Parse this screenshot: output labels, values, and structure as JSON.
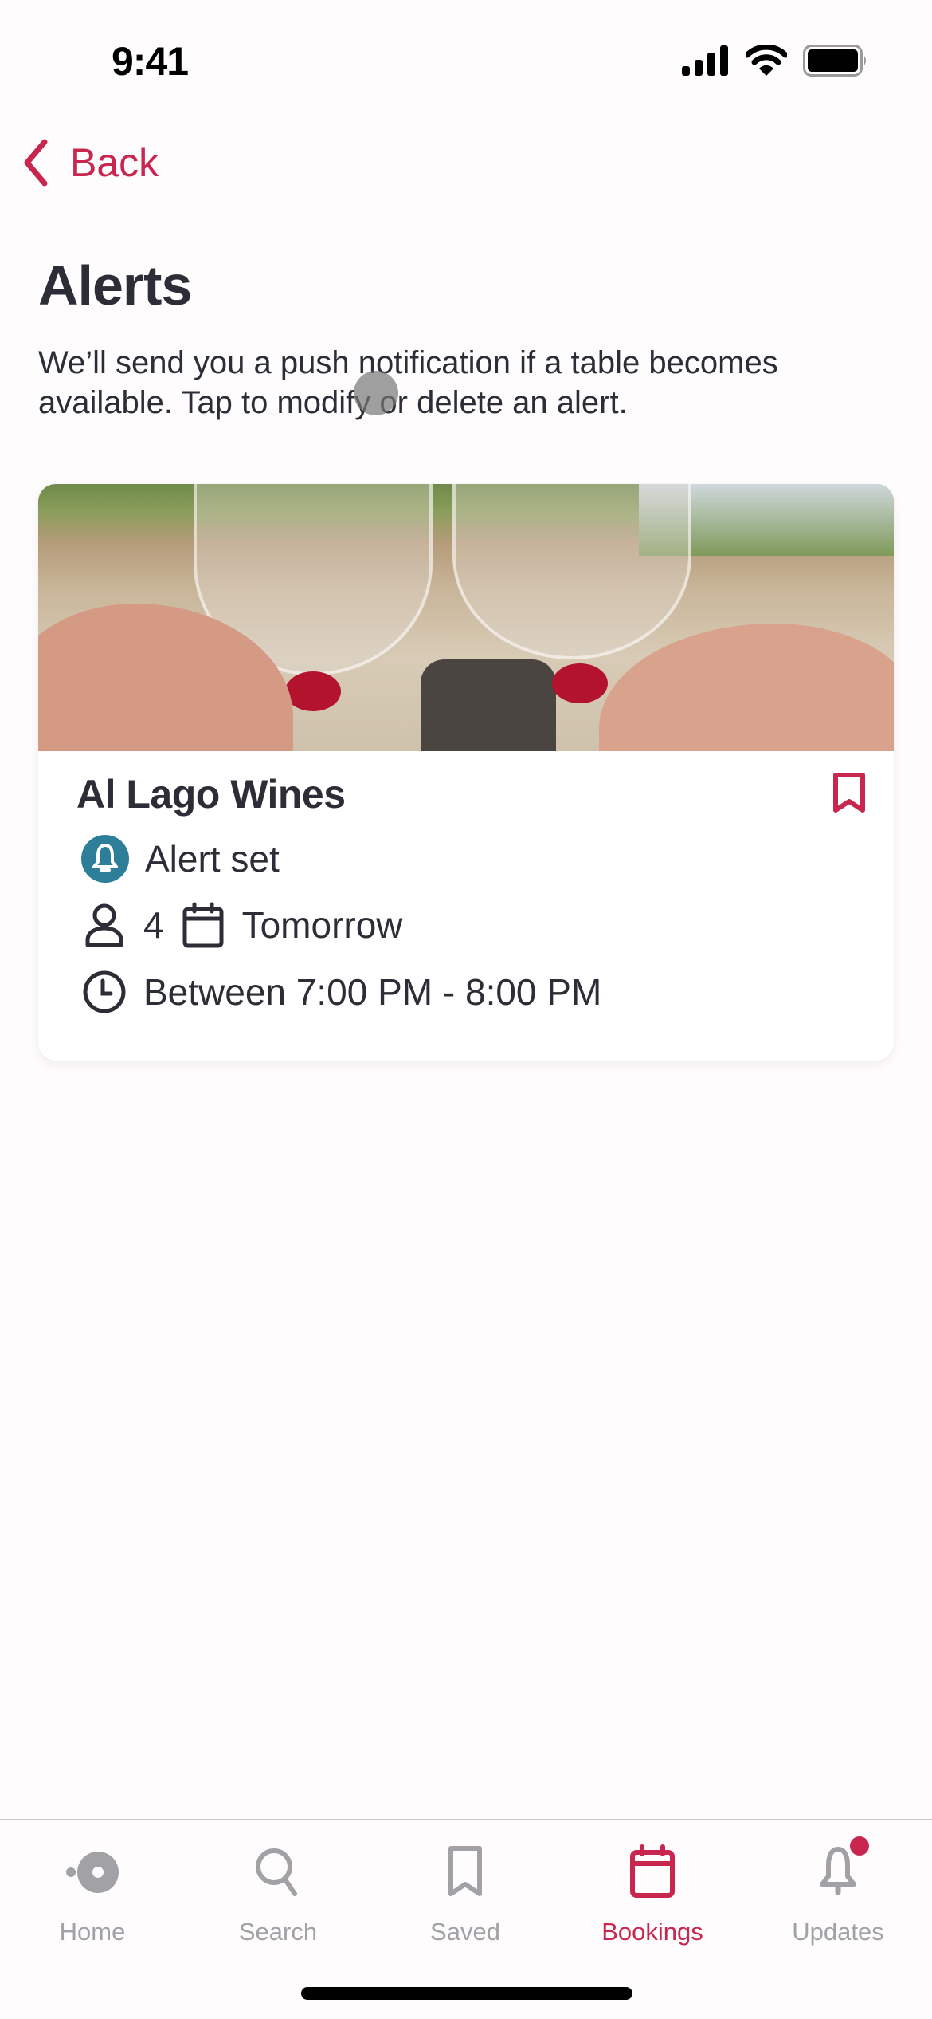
{
  "status_bar": {
    "time": "9:41",
    "icons": [
      "cellular-signal-icon",
      "wifi-icon",
      "battery-icon"
    ]
  },
  "nav": {
    "back_label": "Back",
    "back_icon": "chevron-left-icon"
  },
  "page": {
    "title": "Alerts",
    "description": "We’ll send you a push notification if a table becomes available. Tap to modify or delete an alert."
  },
  "alerts": [
    {
      "restaurant_name": "Al Lago Wines",
      "image_description": "two hands toasting wine glasses engraved 'Al Lago' on a terrace",
      "saved": true,
      "status": "Alert set",
      "party_size": "4",
      "date": "Tomorrow",
      "time_window": "Between 7:00 PM - 8:00 PM"
    }
  ],
  "tabbar": {
    "active": "Bookings",
    "items": [
      {
        "label": "Home",
        "icon": "home-icon"
      },
      {
        "label": "Search",
        "icon": "search-icon"
      },
      {
        "label": "Saved",
        "icon": "bookmark-icon"
      },
      {
        "label": "Bookings",
        "icon": "calendar-icon"
      },
      {
        "label": "Updates",
        "icon": "bell-icon",
        "has_notification": true
      }
    ]
  },
  "colors": {
    "accent": "#c8264f",
    "alert_badge": "#2d7f99",
    "text": "#2d2d37",
    "inactive_tab": "#a1a1a6"
  }
}
